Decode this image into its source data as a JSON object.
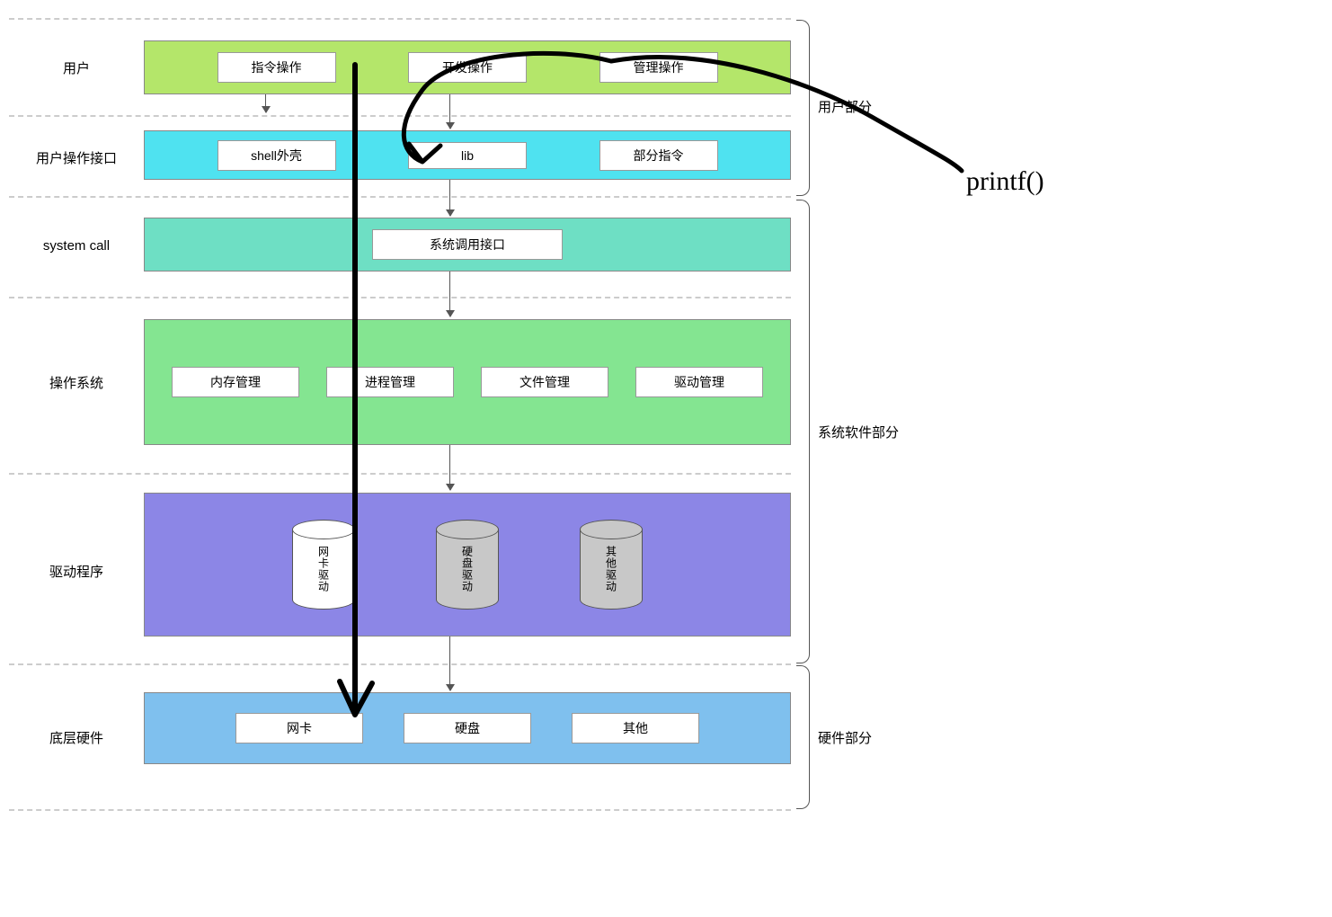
{
  "layers": {
    "user": {
      "label": "用户",
      "boxes": [
        "指令操作",
        "开发操作",
        "管理操作"
      ]
    },
    "iface": {
      "label": "用户操作接口",
      "boxes": [
        "shell外壳",
        "lib",
        "部分指令"
      ]
    },
    "syscall": {
      "label": "system call",
      "boxes": [
        "系统调用接口"
      ]
    },
    "os": {
      "label": "操作系统",
      "boxes": [
        "内存管理",
        "进程管理",
        "文件管理",
        "驱动管理"
      ]
    },
    "driver": {
      "label": "驱动程序",
      "cylinders": [
        {
          "color": "white",
          "label": "网卡驱动"
        },
        {
          "color": "grey",
          "label": "硬盘驱动"
        },
        {
          "color": "grey",
          "label": "其他驱动"
        }
      ]
    },
    "hw": {
      "label": "底层硬件",
      "boxes": [
        "网卡",
        "硬盘",
        "其他"
      ]
    }
  },
  "sections": {
    "user_part": "用户部分",
    "sys_sw_part": "系统软件部分",
    "hw_part": "硬件部分"
  },
  "annotation": "printf()"
}
